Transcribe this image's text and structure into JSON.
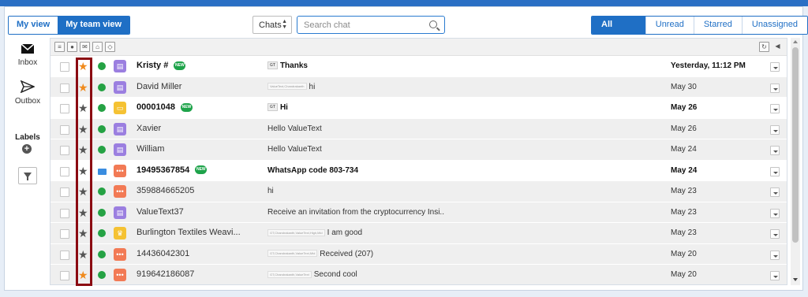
{
  "views": {
    "my_view": "My view",
    "my_team_view": "My team view"
  },
  "chat_selector": {
    "value": "Chats"
  },
  "search": {
    "placeholder": "Search chat"
  },
  "filters": {
    "all": "All Chats",
    "unread": "Unread",
    "starred": "Starred",
    "unassigned": "Unassigned"
  },
  "nav": {
    "inbox": "Inbox",
    "outbox": "Outbox",
    "labels": "Labels"
  },
  "badge_new": "NEW",
  "colors": {
    "brand": "#1f6fc5",
    "star_on": "#f08a1c",
    "whatsapp": "#25a244",
    "highlight": "#8b0b12"
  },
  "rows": [
    {
      "name": "Kristy #",
      "new": true,
      "tag": "GT",
      "msg": "Thanks",
      "date": "Yesterday, 11:12 PM",
      "unread": true,
      "starred": true,
      "channel": "whatsapp",
      "avatar": "contact"
    },
    {
      "name": "David Miller",
      "tag": "ValueText,Chandrakanth",
      "msg": "hi",
      "date": "May 30",
      "unread": false,
      "starred": true,
      "channel": "whatsapp",
      "avatar": "contact"
    },
    {
      "name": "00001048",
      "new": true,
      "tag": "GT",
      "msg": "Hi",
      "date": "May 26",
      "unread": true,
      "starred": false,
      "channel": "whatsapp",
      "avatar": "folder"
    },
    {
      "name": "Xavier",
      "msg": "Hello ValueText",
      "date": "May 26",
      "unread": false,
      "starred": false,
      "channel": "whatsapp",
      "avatar": "contact"
    },
    {
      "name": "William",
      "msg": "Hello ValueText",
      "date": "May 24",
      "unread": false,
      "starred": false,
      "channel": "whatsapp",
      "avatar": "contact"
    },
    {
      "name": "19495367854",
      "new": true,
      "msg": "WhatsApp code 803-734",
      "date": "May 24",
      "unread": true,
      "starred": false,
      "channel": "message",
      "avatar": "chat"
    },
    {
      "name": "359884665205",
      "msg": "hi",
      "date": "May 23",
      "unread": false,
      "starred": false,
      "channel": "whatsapp",
      "avatar": "chat"
    },
    {
      "name": "ValueText37",
      "msg": "Receive an invitation from the cryptocurrency Insi..",
      "date": "May 23",
      "unread": false,
      "starred": false,
      "channel": "whatsapp",
      "avatar": "contact"
    },
    {
      "name": "Burlington Textiles Weavi...",
      "tag": "GT,Chandrakanth,ValueText,High,Mid",
      "msg": "I am good",
      "date": "May 23",
      "unread": false,
      "starred": false,
      "channel": "whatsapp",
      "avatar": "crown"
    },
    {
      "name": "14436042301",
      "tag": "GT,Chandrakanth,ValueText,Mid",
      "msg": "Received (207)",
      "date": "May 20",
      "unread": false,
      "starred": false,
      "channel": "whatsapp",
      "avatar": "chat"
    },
    {
      "name": "919642186087",
      "tag": "GT,Chandrakanth,ValueText",
      "msg": "Second cool",
      "date": "May 20",
      "unread": false,
      "starred": true,
      "channel": "whatsapp",
      "avatar": "chat"
    }
  ]
}
